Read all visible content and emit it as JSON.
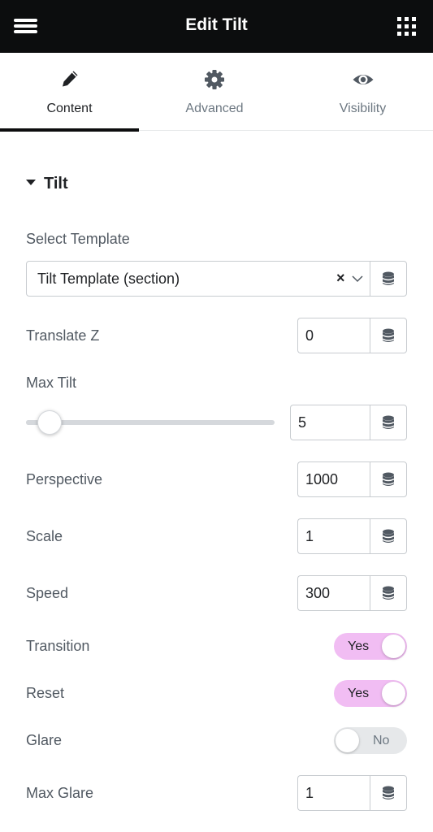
{
  "header": {
    "title": "Edit Tilt",
    "menu_icon": "hamburger-icon",
    "apps_icon": "grid-icon"
  },
  "tabs": [
    {
      "label": "Content",
      "icon": "pencil-icon",
      "active": true
    },
    {
      "label": "Advanced",
      "icon": "gear-icon",
      "active": false
    },
    {
      "label": "Visibility",
      "icon": "eye-icon",
      "active": false
    }
  ],
  "section": {
    "title": "Tilt"
  },
  "fields": {
    "select_template": {
      "label": "Select Template",
      "value": "Tilt Template (section)",
      "clear": "×"
    },
    "translate_z": {
      "label": "Translate Z",
      "value": "0"
    },
    "max_tilt": {
      "label": "Max Tilt",
      "value": "5",
      "slider_fraction": 0.05
    },
    "perspective": {
      "label": "Perspective",
      "value": "1000"
    },
    "scale": {
      "label": "Scale",
      "value": "1"
    },
    "speed": {
      "label": "Speed",
      "value": "300"
    },
    "transition": {
      "label": "Transition",
      "state": "Yes"
    },
    "reset": {
      "label": "Reset",
      "state": "Yes"
    },
    "glare": {
      "label": "Glare",
      "state": "No"
    },
    "max_glare": {
      "label": "Max Glare",
      "value": "1"
    }
  },
  "colors": {
    "header_bg": "#0c0d0e",
    "toggle_on": "#f1bdf3",
    "toggle_off": "#e6e8ea"
  }
}
